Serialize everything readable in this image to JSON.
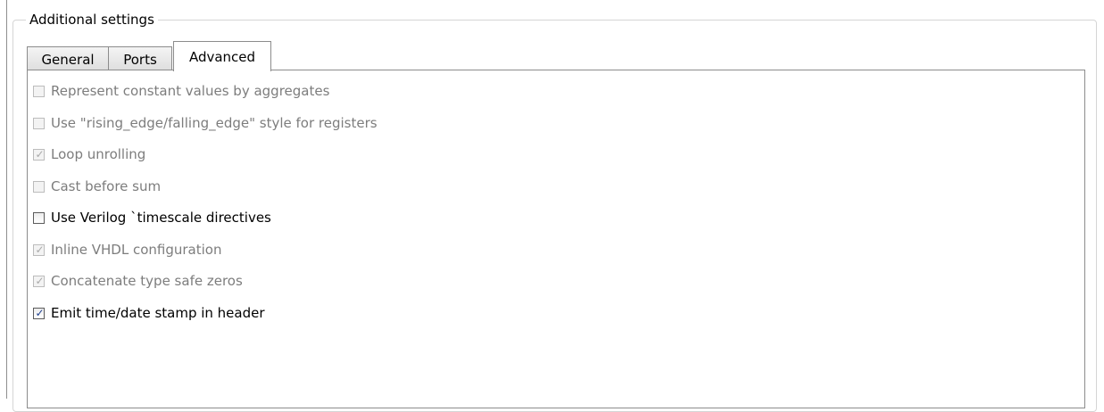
{
  "group_title": "Additional settings",
  "tabs": [
    {
      "label": "General",
      "selected": false
    },
    {
      "label": "Ports",
      "selected": false
    },
    {
      "label": "Advanced",
      "selected": true
    }
  ],
  "options": [
    {
      "label": "Represent constant values by aggregates",
      "checked": false,
      "enabled": false
    },
    {
      "label": "Use \"rising_edge/falling_edge\" style for registers",
      "checked": false,
      "enabled": false
    },
    {
      "label": "Loop unrolling",
      "checked": true,
      "enabled": false
    },
    {
      "label": "Cast before sum",
      "checked": false,
      "enabled": false
    },
    {
      "label": "Use Verilog `timescale directives",
      "checked": false,
      "enabled": true
    },
    {
      "label": "Inline VHDL configuration",
      "checked": true,
      "enabled": false
    },
    {
      "label": "Concatenate type safe zeros",
      "checked": true,
      "enabled": false
    },
    {
      "label": "Emit time/date stamp in header",
      "checked": true,
      "enabled": true
    }
  ],
  "checkmark_glyph": "✓"
}
